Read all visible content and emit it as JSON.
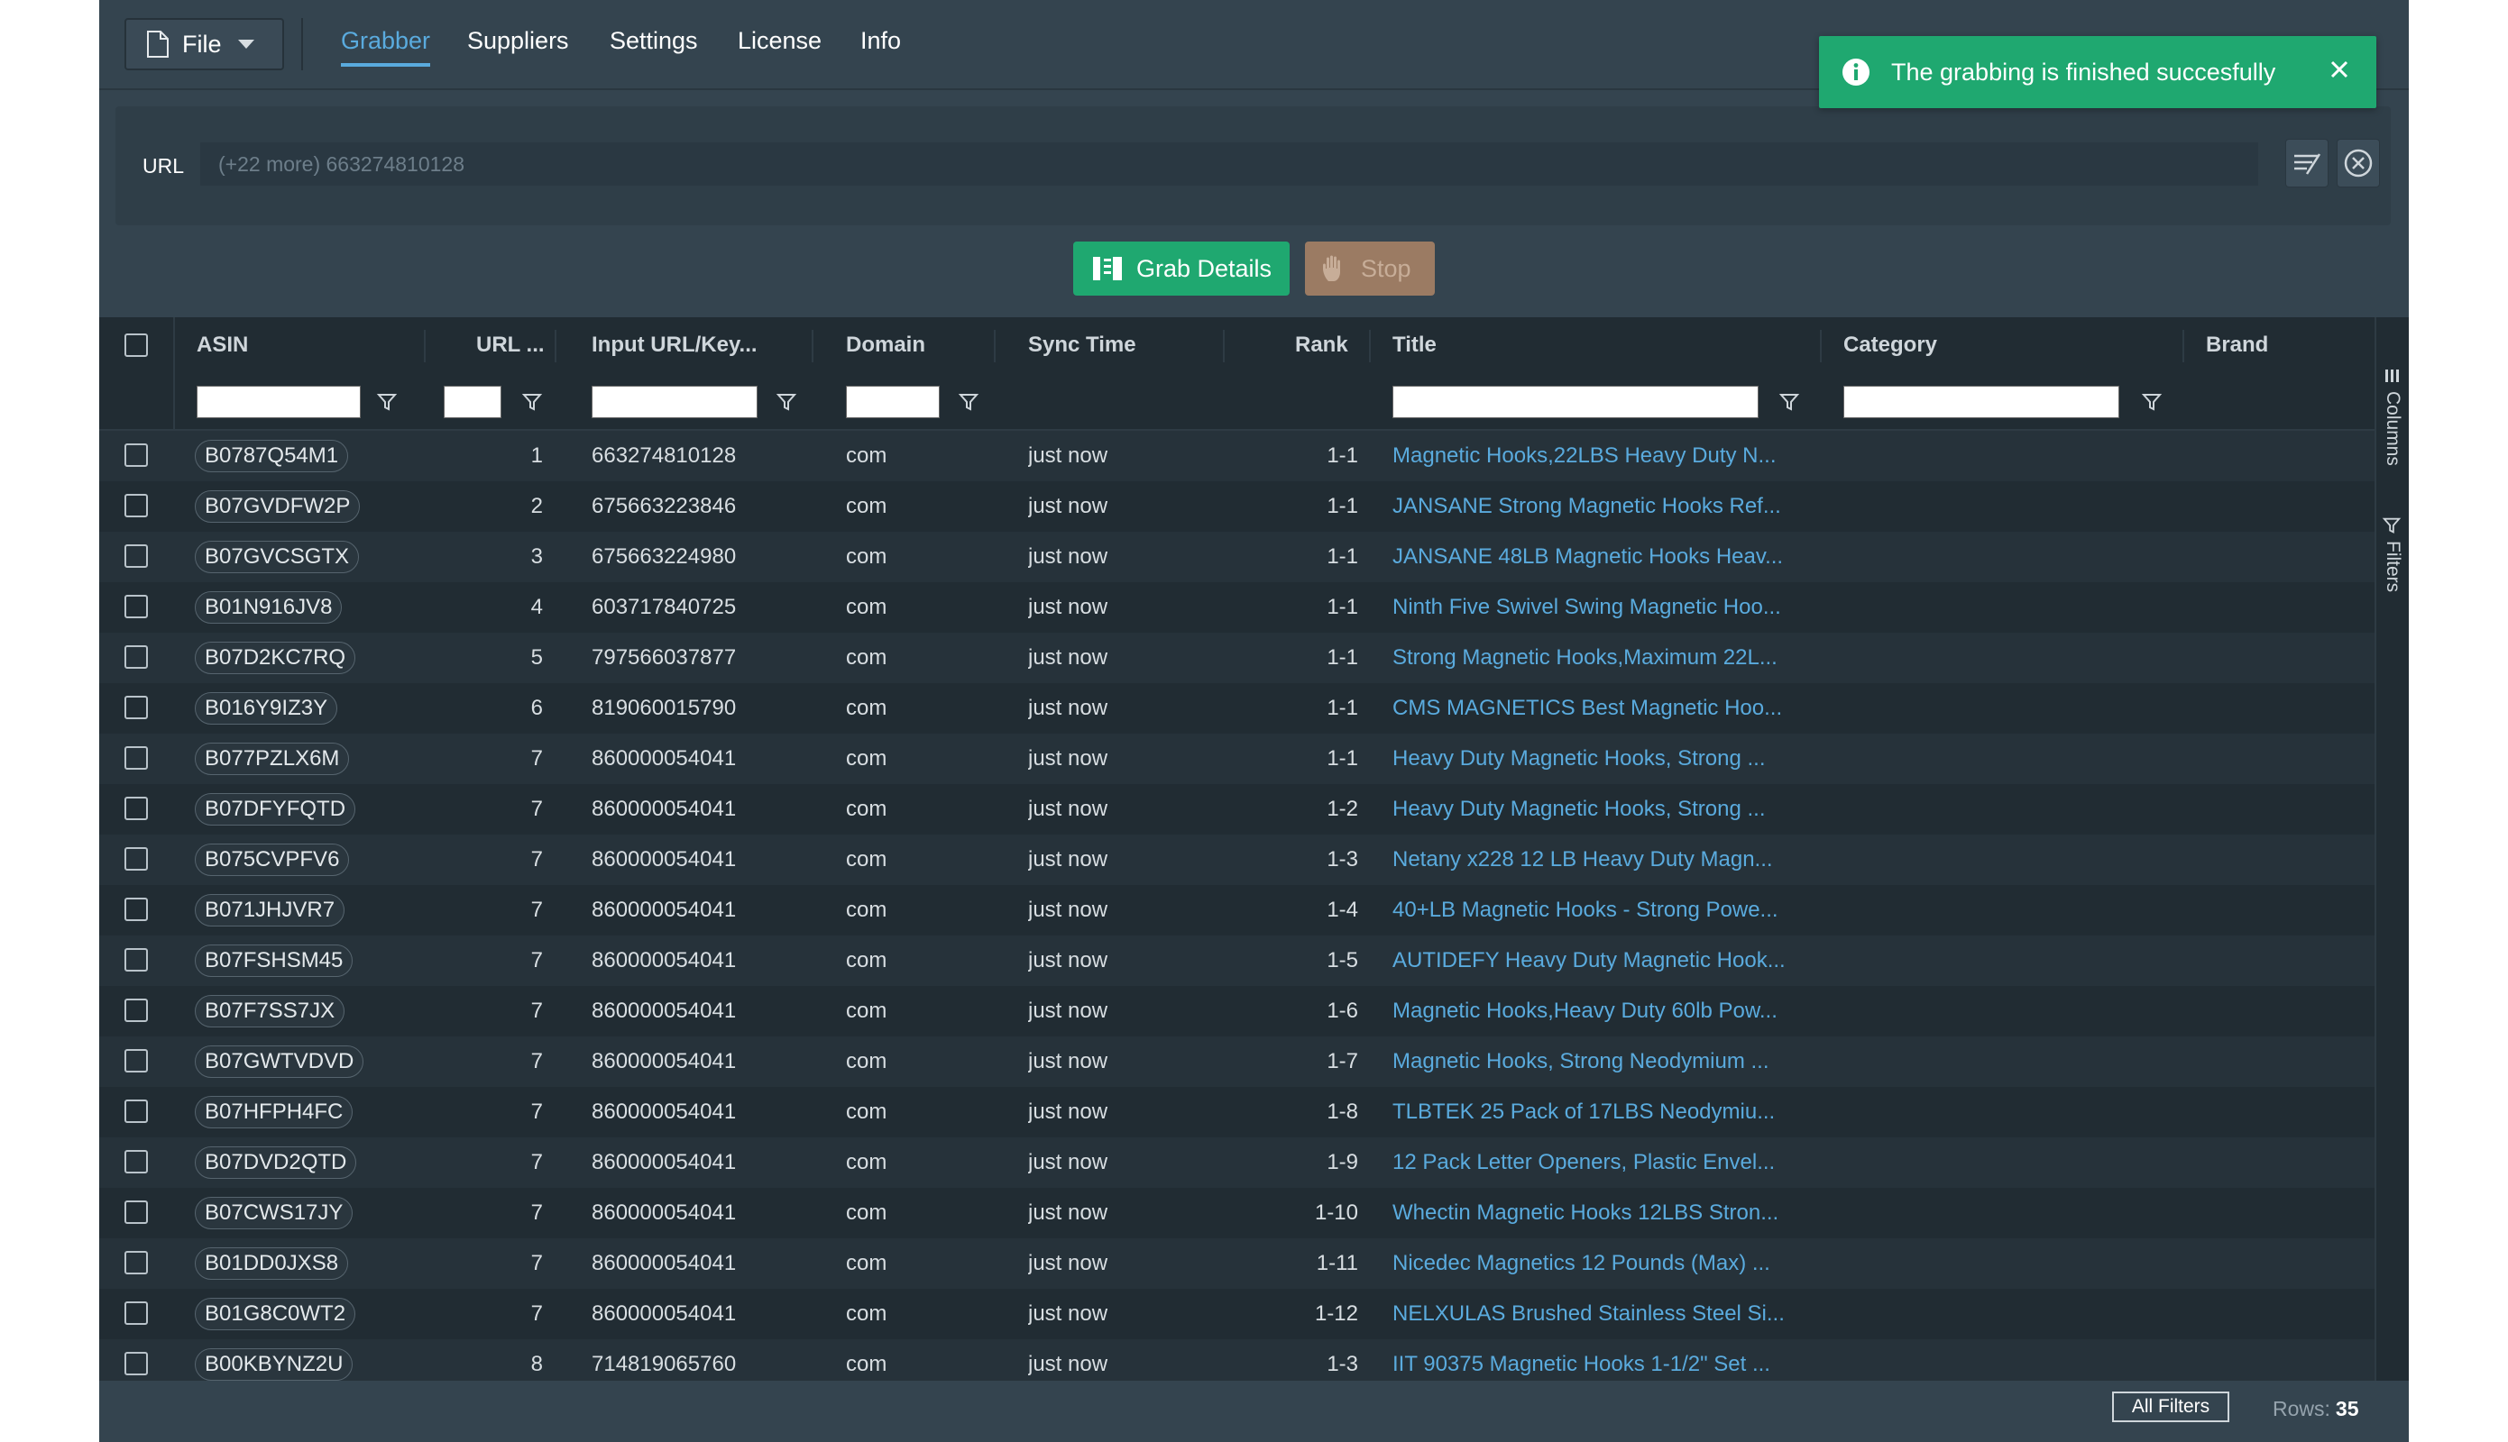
{
  "nav": {
    "file_label": "File",
    "tabs": [
      {
        "label": "Grabber",
        "active": true
      },
      {
        "label": "Suppliers",
        "active": false
      },
      {
        "label": "Settings",
        "active": false
      },
      {
        "label": "License",
        "active": false
      },
      {
        "label": "Info",
        "active": false
      }
    ]
  },
  "toast": {
    "message": "The grabbing is finished succesfully"
  },
  "url_bar": {
    "label": "URL",
    "placeholder": "(+22 more) 663274810128"
  },
  "actions": {
    "grab_label": "Grab Details",
    "stop_label": "Stop"
  },
  "grid": {
    "columns": [
      "ASIN",
      "URL ...",
      "Input URL/Key...",
      "Domain",
      "Sync Time",
      "Rank",
      "Title",
      "Category",
      "Brand"
    ],
    "rows": [
      {
        "asin": "B0787Q54M1",
        "url_idx": "1",
        "input": "663274810128",
        "domain": "com",
        "sync": "just now",
        "rank": "1-1",
        "title": "Magnetic Hooks,22LBS Heavy Duty N..."
      },
      {
        "asin": "B07GVDFW2P",
        "url_idx": "2",
        "input": "675663223846",
        "domain": "com",
        "sync": "just now",
        "rank": "1-1",
        "title": "JANSANE Strong Magnetic Hooks Ref..."
      },
      {
        "asin": "B07GVCSGTX",
        "url_idx": "3",
        "input": "675663224980",
        "domain": "com",
        "sync": "just now",
        "rank": "1-1",
        "title": "JANSANE 48LB Magnetic Hooks Heav..."
      },
      {
        "asin": "B01N916JV8",
        "url_idx": "4",
        "input": "603717840725",
        "domain": "com",
        "sync": "just now",
        "rank": "1-1",
        "title": "Ninth Five Swivel Swing Magnetic Hoo..."
      },
      {
        "asin": "B07D2KC7RQ",
        "url_idx": "5",
        "input": "797566037877",
        "domain": "com",
        "sync": "just now",
        "rank": "1-1",
        "title": "Strong Magnetic Hooks,Maximum 22L..."
      },
      {
        "asin": "B016Y9IZ3Y",
        "url_idx": "6",
        "input": "819060015790",
        "domain": "com",
        "sync": "just now",
        "rank": "1-1",
        "title": "CMS MAGNETICS Best Magnetic Hoo..."
      },
      {
        "asin": "B077PZLX6M",
        "url_idx": "7",
        "input": "860000054041",
        "domain": "com",
        "sync": "just now",
        "rank": "1-1",
        "title": "Heavy Duty Magnetic Hooks, Strong ..."
      },
      {
        "asin": "B07DFYFQTD",
        "url_idx": "7",
        "input": "860000054041",
        "domain": "com",
        "sync": "just now",
        "rank": "1-2",
        "title": "Heavy Duty Magnetic Hooks, Strong ..."
      },
      {
        "asin": "B075CVPFV6",
        "url_idx": "7",
        "input": "860000054041",
        "domain": "com",
        "sync": "just now",
        "rank": "1-3",
        "title": "Netany x228 12 LB Heavy Duty Magn..."
      },
      {
        "asin": "B071JHJVR7",
        "url_idx": "7",
        "input": "860000054041",
        "domain": "com",
        "sync": "just now",
        "rank": "1-4",
        "title": "40+LB Magnetic Hooks - Strong Powe..."
      },
      {
        "asin": "B07FSHSM45",
        "url_idx": "7",
        "input": "860000054041",
        "domain": "com",
        "sync": "just now",
        "rank": "1-5",
        "title": "AUTIDEFY Heavy Duty Magnetic Hook..."
      },
      {
        "asin": "B07F7SS7JX",
        "url_idx": "7",
        "input": "860000054041",
        "domain": "com",
        "sync": "just now",
        "rank": "1-6",
        "title": "Magnetic Hooks,Heavy Duty 60lb Pow..."
      },
      {
        "asin": "B07GWTVDVD",
        "url_idx": "7",
        "input": "860000054041",
        "domain": "com",
        "sync": "just now",
        "rank": "1-7",
        "title": "Magnetic Hooks, Strong Neodymium ..."
      },
      {
        "asin": "B07HFPH4FC",
        "url_idx": "7",
        "input": "860000054041",
        "domain": "com",
        "sync": "just now",
        "rank": "1-8",
        "title": "TLBTEK 25 Pack of 17LBS Neodymiu..."
      },
      {
        "asin": "B07DVD2QTD",
        "url_idx": "7",
        "input": "860000054041",
        "domain": "com",
        "sync": "just now",
        "rank": "1-9",
        "title": "12 Pack Letter Openers, Plastic Envel..."
      },
      {
        "asin": "B07CWS17JY",
        "url_idx": "7",
        "input": "860000054041",
        "domain": "com",
        "sync": "just now",
        "rank": "1-10",
        "title": "Whectin Magnetic Hooks 12LBS Stron..."
      },
      {
        "asin": "B01DD0JXS8",
        "url_idx": "7",
        "input": "860000054041",
        "domain": "com",
        "sync": "just now",
        "rank": "1-11",
        "title": "Nicedec Magnetics 12 Pounds (Max) ..."
      },
      {
        "asin": "B01G8C0WT2",
        "url_idx": "7",
        "input": "860000054041",
        "domain": "com",
        "sync": "just now",
        "rank": "1-12",
        "title": "NELXULAS Brushed Stainless Steel Si..."
      },
      {
        "asin": "B00KBYNZ2U",
        "url_idx": "8",
        "input": "714819065760",
        "domain": "com",
        "sync": "just now",
        "rank": "1-3",
        "title": "IIT 90375 Magnetic Hooks 1-1/2\" Set ..."
      }
    ]
  },
  "side_panel": {
    "columns_label": "Columns",
    "filters_label": "Filters"
  },
  "footer": {
    "all_filters_label": "All Filters",
    "rows_label": "Rows:",
    "rows_value": "35"
  },
  "colors": {
    "accent": "#5aabde",
    "success": "#1fa870",
    "stop": "#9b7b63",
    "bg": "#34444f",
    "grid_bg": "#212c33"
  }
}
